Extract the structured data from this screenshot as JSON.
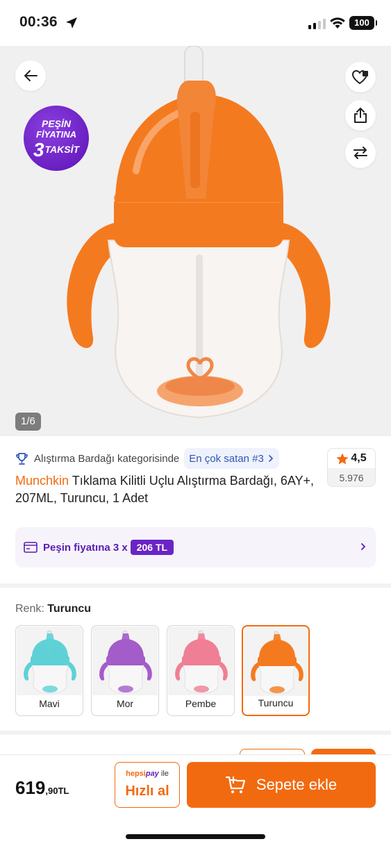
{
  "status_bar": {
    "time": "00:36",
    "battery": "100"
  },
  "hero": {
    "badge": {
      "line1": "PEŞİN",
      "line2": "FİYATINA",
      "number": "3",
      "word": "TAKSİT"
    },
    "counter": "1/6",
    "product_color": "#f47a1f"
  },
  "product": {
    "category_text": "Alıştırma Bardağı kategorisinde",
    "best_seller": "En çok satan #3",
    "rating": "4,5",
    "review_count": "5.976",
    "brand": "Munchkin",
    "title": "Tıklama Kilitli Uçlu Alıştırma Bardağı, 6AY+, 207ML, Turuncu, 1 Adet"
  },
  "installment": {
    "text": "Peşin fiyatına 3 x",
    "amount": "206 TL"
  },
  "color_selector": {
    "label": "Renk:",
    "selected": "Turuncu",
    "options": [
      {
        "name": "Mavi",
        "color": "#5fd1d6"
      },
      {
        "name": "Mor",
        "color": "#a35cc9"
      },
      {
        "name": "Pembe",
        "color": "#ef7f95"
      },
      {
        "name": "Turuncu",
        "color": "#f47a1f"
      }
    ]
  },
  "bottom_bar": {
    "price_int": "619",
    "price_dec": ",90TL",
    "hepsi": "hepsi",
    "pay": "pay",
    "ile": "ile",
    "quick_buy": "Hızlı al",
    "add_to_cart": "Sepete ekle"
  },
  "colors": {
    "accent": "#f26a10",
    "purple": "#6a24c5",
    "link_blue": "#3155b5"
  }
}
